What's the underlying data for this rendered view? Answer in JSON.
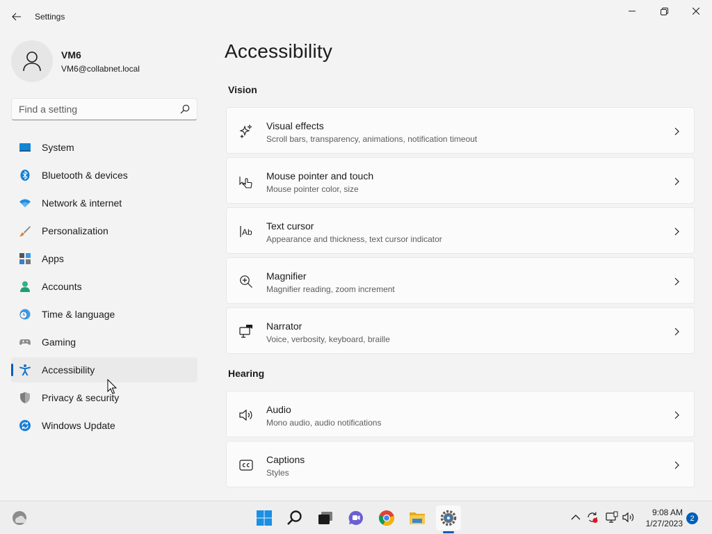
{
  "window": {
    "title": "Settings",
    "buttons": {
      "minimize_icon": "minimize-icon",
      "maximize_icon": "restore-icon",
      "close_icon": "close-icon"
    }
  },
  "profile": {
    "name": "VM6",
    "email": "VM6@collabnet.local"
  },
  "search": {
    "placeholder": "Find a setting",
    "value": ""
  },
  "sidebar": {
    "items": [
      {
        "label": "System",
        "icon": "system-icon",
        "active": false
      },
      {
        "label": "Bluetooth & devices",
        "icon": "bluetooth-icon",
        "active": false
      },
      {
        "label": "Network & internet",
        "icon": "wifi-icon",
        "active": false
      },
      {
        "label": "Personalization",
        "icon": "brush-icon",
        "active": false
      },
      {
        "label": "Apps",
        "icon": "apps-icon",
        "active": false
      },
      {
        "label": "Accounts",
        "icon": "accounts-icon",
        "active": false
      },
      {
        "label": "Time & language",
        "icon": "clock-globe-icon",
        "active": false
      },
      {
        "label": "Gaming",
        "icon": "gamepad-icon",
        "active": false
      },
      {
        "label": "Accessibility",
        "icon": "accessibility-icon",
        "active": true
      },
      {
        "label": "Privacy & security",
        "icon": "shield-icon",
        "active": false
      },
      {
        "label": "Windows Update",
        "icon": "update-icon",
        "active": false
      }
    ]
  },
  "main": {
    "title": "Accessibility",
    "sections": [
      {
        "title": "Vision",
        "items": [
          {
            "title": "Visual effects",
            "desc": "Scroll bars, transparency, animations, notification timeout",
            "icon": "sparkle-icon"
          },
          {
            "title": "Mouse pointer and touch",
            "desc": "Mouse pointer color, size",
            "icon": "pointer-touch-icon"
          },
          {
            "title": "Text cursor",
            "desc": "Appearance and thickness, text cursor indicator",
            "icon": "text-cursor-icon"
          },
          {
            "title": "Magnifier",
            "desc": "Magnifier reading, zoom increment",
            "icon": "magnifier-icon"
          },
          {
            "title": "Narrator",
            "desc": "Voice, verbosity, keyboard, braille",
            "icon": "narrator-icon"
          }
        ]
      },
      {
        "title": "Hearing",
        "items": [
          {
            "title": "Audio",
            "desc": "Mono audio, audio notifications",
            "icon": "speaker-icon"
          },
          {
            "title": "Captions",
            "desc": "Styles",
            "icon": "captions-icon"
          }
        ]
      }
    ]
  },
  "taskbar": {
    "apps": [
      "weather-icon",
      "start-icon",
      "search-icon",
      "task-view-icon",
      "teams-chat-icon",
      "chrome-icon",
      "file-explorer-icon",
      "settings-icon"
    ],
    "tray": [
      "chevron-up-icon",
      "sync-icon",
      "network-monitor-icon",
      "volume-icon"
    ],
    "time": "9:08 AM",
    "date": "1/27/2023",
    "notification_count": "2"
  },
  "colors": {
    "accent": "#005fb8",
    "background": "#f3f3f3",
    "card": "#fbfbfb"
  }
}
